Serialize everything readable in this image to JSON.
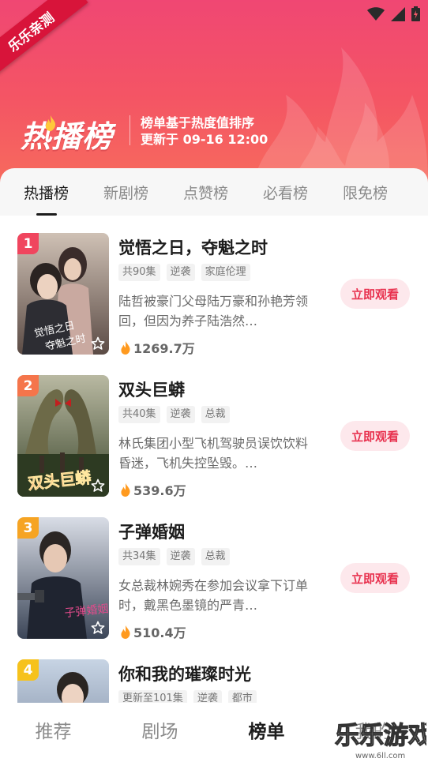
{
  "ribbon": {
    "text": "乐乐亲测"
  },
  "header": {
    "title": "热播榜",
    "subtitle_line1": "榜单基于热度值排序",
    "subtitle_line2": "更新于 09-16 12:00"
  },
  "tabs": [
    {
      "label": "热播榜",
      "active": true
    },
    {
      "label": "新剧榜",
      "active": false
    },
    {
      "label": "点赞榜",
      "active": false
    },
    {
      "label": "必看榜",
      "active": false
    },
    {
      "label": "限免榜",
      "active": false
    }
  ],
  "dramas": [
    {
      "rank": "1",
      "rank_color": "#f0455e",
      "title": "觉悟之日，夺魁之时",
      "tags": [
        "共90集",
        "逆袭",
        "家庭伦理"
      ],
      "description": "陆哲被豪门父母陆万豪和孙艳芳领回，但因为养子陆浩然…",
      "heat": "1269.7万",
      "button": "立即观看"
    },
    {
      "rank": "2",
      "rank_color": "#f5754b",
      "title": "双头巨蟒",
      "tags": [
        "共40集",
        "逆袭",
        "总裁"
      ],
      "description": "林氏集团小型飞机驾驶员误饮饮料昏迷，飞机失控坠毁。…",
      "heat": "539.6万",
      "button": "立即观看"
    },
    {
      "rank": "3",
      "rank_color": "#f6a423",
      "title": "子弹婚姻",
      "tags": [
        "共34集",
        "逆袭",
        "总裁"
      ],
      "description": "女总裁林婉秀在参加会议拿下订单时，戴黑色墨镜的严青…",
      "heat": "510.4万",
      "button": "立即观看"
    },
    {
      "rank": "4",
      "rank_color": "#f6c21c",
      "title": "你和我的璀璨时光",
      "tags": [
        "更新至101集",
        "逆袭",
        "都市"
      ],
      "description": "",
      "heat": "",
      "button": ""
    }
  ],
  "bottom_nav": [
    {
      "label": "推荐",
      "active": false
    },
    {
      "label": "剧场",
      "active": false
    },
    {
      "label": "榜单",
      "active": true
    },
    {
      "label": "我的",
      "active": false
    }
  ],
  "watermark": {
    "text": "乐乐游戏",
    "url": "www.6ll.com"
  },
  "colors": {
    "accent": "#e8324f",
    "header_gradient_top": "#f04773",
    "header_gradient_bottom": "#f8745a"
  },
  "icons": {
    "status": [
      "wifi-icon",
      "cellular-signal-icon",
      "battery-charging-icon"
    ],
    "heat": "flame-icon",
    "favorite": "star-outline-icon"
  }
}
